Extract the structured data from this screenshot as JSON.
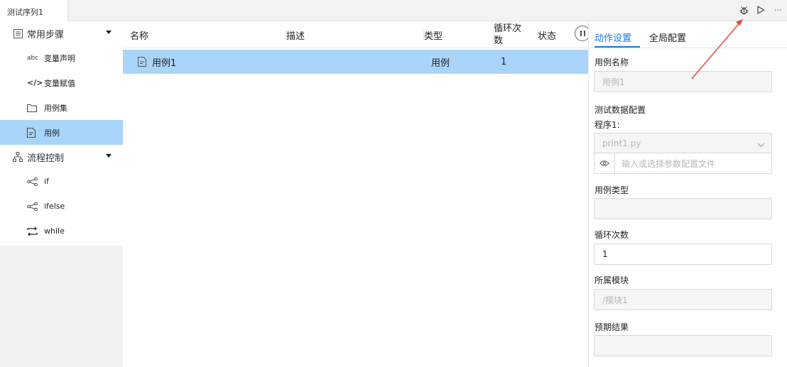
{
  "tab": {
    "title": "测试序列1"
  },
  "toolbar": {
    "debug_icon": "bug-icon",
    "run_icon": "play-icon",
    "more_label": "···"
  },
  "left": {
    "groups": [
      {
        "label": "常用步骤",
        "icon": "list-icon",
        "items": [
          {
            "label": "变量声明",
            "icon_text": "abc"
          },
          {
            "label": "变量赋值",
            "icon_text": "</>"
          },
          {
            "label": "用例集",
            "icon": "folder-icon"
          },
          {
            "label": "用例",
            "icon": "file-icon",
            "active": true
          }
        ]
      },
      {
        "label": "流程控制",
        "icon": "hierarchy-icon",
        "items": [
          {
            "label": "if",
            "icon": "branch-icon"
          },
          {
            "label": "ifelse",
            "icon": "branch-icon"
          },
          {
            "label": "while",
            "icon": "loop-icon"
          }
        ]
      }
    ]
  },
  "table": {
    "columns": [
      "名称",
      "描述",
      "类型",
      "循环次数",
      "状态"
    ],
    "loop_col_lines": [
      "循环次",
      "数"
    ],
    "rows": [
      {
        "name": "用例1",
        "desc": "",
        "type": "用例",
        "loop": "1",
        "status": ""
      }
    ]
  },
  "right": {
    "tabs": [
      "动作设置",
      "全局配置"
    ],
    "active_tab": "动作设置",
    "case_name_label": "用例名称",
    "case_name_value": "用例1",
    "test_data_label": "测试数据配置",
    "program_label": "程序1:",
    "program_value": "print1.py",
    "param_placeholder": "输入或选择参数配置文件",
    "case_type_label": "用例类型",
    "case_type_value": "",
    "loop_label": "循环次数",
    "loop_value": "1",
    "module_label": "所属模块",
    "module_value": "/模块1",
    "expected_label": "预期结果",
    "expected_value": ""
  },
  "colors": {
    "accent": "#1677e6",
    "selected_row": "#aad5fb",
    "annotation_arrow": "#e8473c"
  }
}
